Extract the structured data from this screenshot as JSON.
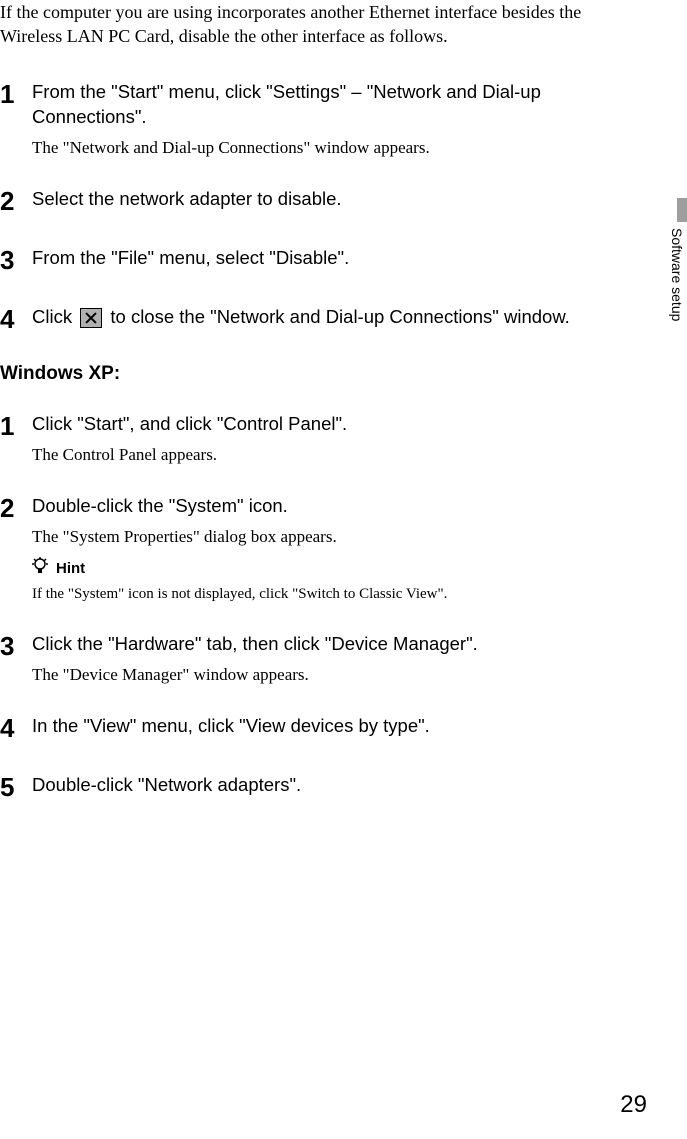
{
  "intro": "If the computer you are using incorporates another Ethernet interface besides the Wireless LAN PC Card, disable the other interface as follows.",
  "sectionA": {
    "steps": [
      {
        "num": "1",
        "title": "From the \"Start\" menu, click \"Settings\" – \"Network and Dial-up Connections\".",
        "desc": "The \"Network and Dial-up Connections\" window appears."
      },
      {
        "num": "2",
        "title": "Select the network adapter to disable."
      },
      {
        "num": "3",
        "title": "From the \"File\" menu, select \"Disable\"."
      },
      {
        "num": "4",
        "title_pre": "Click ",
        "title_post": " to close the \"Network and Dial-up Connections\" window."
      }
    ]
  },
  "sectionB": {
    "header": "Windows XP:",
    "steps": [
      {
        "num": "1",
        "title": "Click \"Start\", and click \"Control Panel\".",
        "desc": "The Control Panel appears."
      },
      {
        "num": "2",
        "title": "Double-click the \"System\" icon.",
        "desc": "The \"System Properties\" dialog box appears.",
        "hint_label": "Hint",
        "hint_text": "If the \"System\" icon is not displayed, click \"Switch to Classic View\"."
      },
      {
        "num": "3",
        "title": "Click the \"Hardware\" tab, then click \"Device Manager\".",
        "desc": "The \"Device Manager\" window appears."
      },
      {
        "num": "4",
        "title": "In the \"View\" menu, click \"View devices by type\"."
      },
      {
        "num": "5",
        "title": "Double-click \"Network adapters\"."
      }
    ]
  },
  "side_tab": "Software setup",
  "page_number": "29"
}
